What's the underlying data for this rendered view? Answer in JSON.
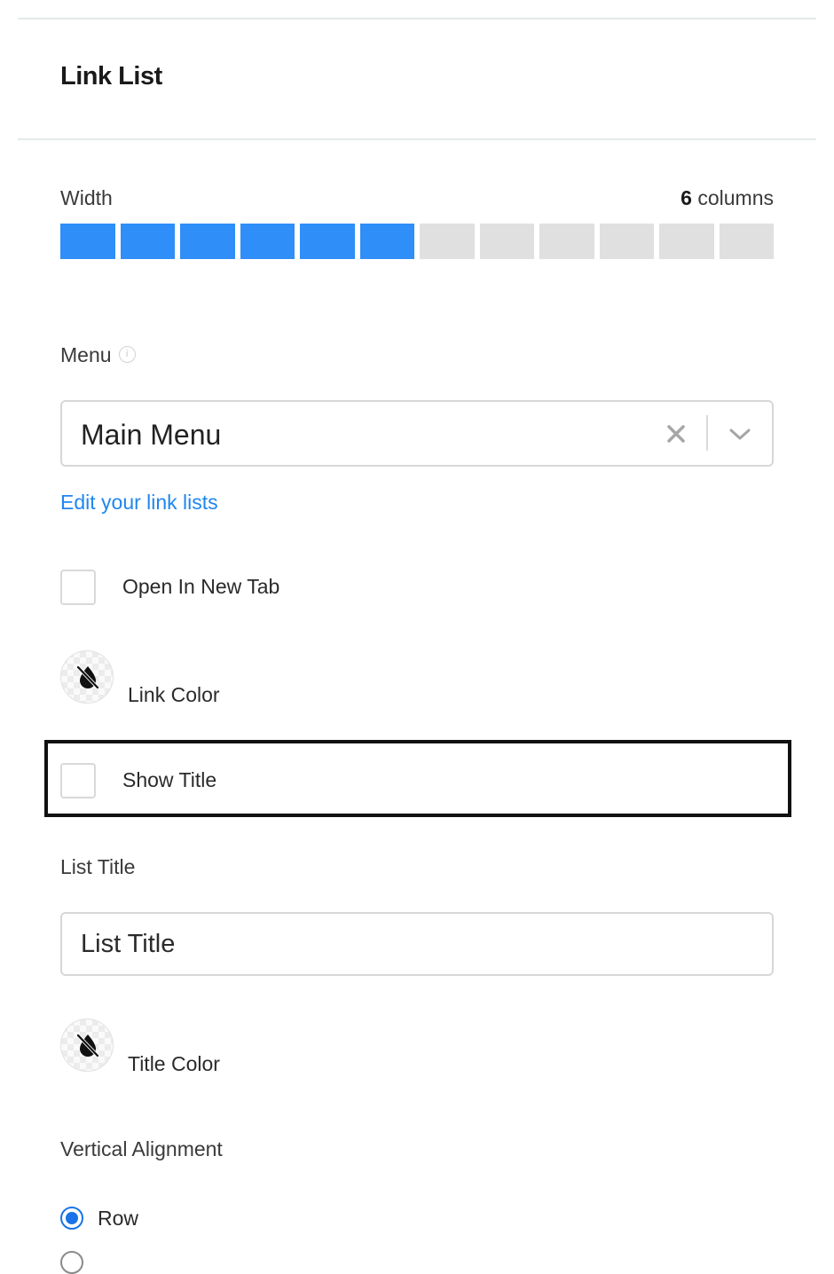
{
  "panel": {
    "title": "Link List"
  },
  "width": {
    "label": "Width",
    "value": "6",
    "unit": " columns",
    "selected_columns": 6,
    "total_columns": 12,
    "active_color": "#2f8ef7",
    "inactive_color": "#e0e0e0"
  },
  "menu": {
    "label": "Menu",
    "info_icon": "info-icon",
    "selected": "Main Menu",
    "clear_icon": "close-icon",
    "dropdown_icon": "chevron-down-icon",
    "edit_link": "Edit your link lists"
  },
  "options": {
    "open_new_tab": {
      "label": "Open In New Tab",
      "checked": false
    },
    "link_color": {
      "label": "Link Color",
      "icon": "no-color-drop-icon"
    },
    "show_title": {
      "label": "Show Title",
      "checked": false
    }
  },
  "list_title": {
    "label": "List Title",
    "placeholder": "List Title"
  },
  "title_color": {
    "label": "Title Color",
    "icon": "no-color-drop-icon"
  },
  "alignment": {
    "label": "Vertical Alignment",
    "options": [
      {
        "label": "Row",
        "selected": true
      }
    ]
  },
  "colors": {
    "accent": "#1a73e8",
    "link": "#1f86f0",
    "focus_outline": "#111111"
  }
}
